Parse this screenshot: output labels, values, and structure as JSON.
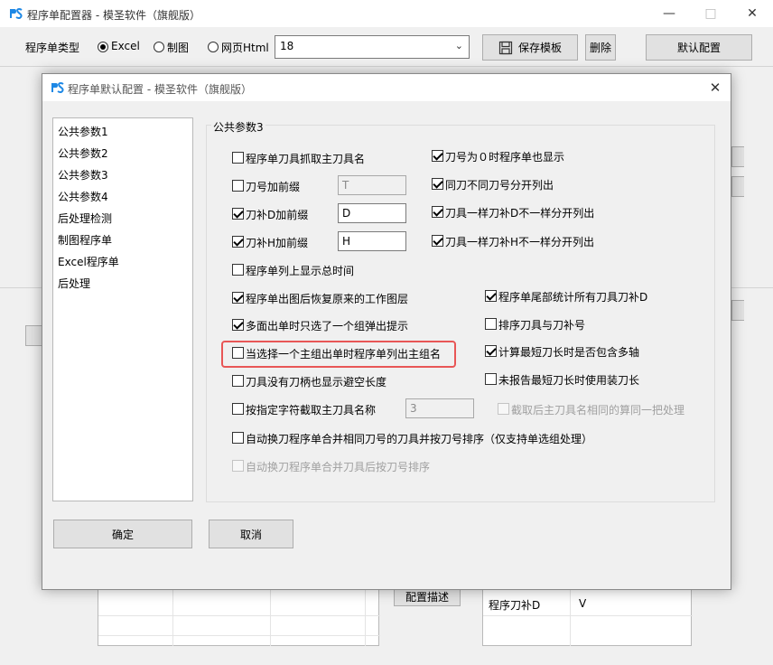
{
  "main_window": {
    "title": "程序单配置器 - 模圣软件（旗舰版）",
    "type_label": "程序单类型",
    "radio_excel": "Excel",
    "radio_draw": "制图",
    "radio_html": "网页Html",
    "combo_value": "18",
    "save_template_label": "保存模板",
    "delete_label": "删除",
    "default_config_label": "默认配置",
    "config_desc_label": "配置描述",
    "bottom_table": {
      "col1": "程序刀补D",
      "col2": "V"
    }
  },
  "dialog": {
    "title": "程序单默认配置 - 模圣软件（旗舰版）",
    "nav_items": [
      {
        "label": "公共参数1"
      },
      {
        "label": "公共参数2"
      },
      {
        "label": "公共参数3"
      },
      {
        "label": "公共参数4"
      },
      {
        "label": "后处理检测"
      },
      {
        "label": "制图程序单"
      },
      {
        "label": "Excel程序单"
      },
      {
        "label": "后处理"
      }
    ],
    "group_title": "公共参数3",
    "options": {
      "opt1": {
        "label": "程序单刀具抓取主刀具名",
        "checked": false
      },
      "opt2": {
        "label": "刀号加前缀",
        "checked": false,
        "value": "T"
      },
      "opt3": {
        "label": "刀补D加前缀",
        "checked": true,
        "value": "D"
      },
      "opt4": {
        "label": "刀补H加前缀",
        "checked": true,
        "value": "H"
      },
      "opt5": {
        "label": "程序单列上显示总时间",
        "checked": false
      },
      "opt6": {
        "label": "程序单出图后恢复原来的工作图层",
        "checked": true
      },
      "opt7": {
        "label": "多面出单时只选了一个组弹出提示",
        "checked": true
      },
      "opt8": {
        "label": "当选择一个主组出单时程序单列出主组名",
        "checked": false
      },
      "opt9": {
        "label": "刀具没有刀柄也显示避空长度",
        "checked": false
      },
      "opt10": {
        "label": "按指定字符截取主刀具名称",
        "checked": false,
        "value": "3"
      },
      "opt11": {
        "label": "自动换刀程序单合并相同刀号的刀具并按刀号排序（仅支持单选组处理）",
        "checked": false
      },
      "opt12": {
        "label": "自动换刀程序单合并刀具后按刀号排序",
        "checked": false,
        "disabled": true
      },
      "opt13": {
        "label": "刀号为０时程序单也显示",
        "checked": true
      },
      "opt14": {
        "label": "同刀不同刀号分开列出",
        "checked": true
      },
      "opt15": {
        "label": "刀具一样刀补D不一样分开列出",
        "checked": true
      },
      "opt16": {
        "label": "刀具一样刀补H不一样分开列出",
        "checked": true
      },
      "opt17": {
        "label": "程序单尾部统计所有刀具刀补D",
        "checked": true
      },
      "opt18": {
        "label": "排序刀具与刀补号",
        "checked": false
      },
      "opt19": {
        "label": "计算最短刀长时是否包含多轴",
        "checked": true
      },
      "opt20": {
        "label": "未报告最短刀长时使用装刀长",
        "checked": false
      },
      "opt21": {
        "label": "截取后主刀具名相同的算同一把处理",
        "checked": false,
        "disabled": true
      }
    },
    "ok_label": "确定",
    "cancel_label": "取消"
  },
  "colors": {
    "highlight": "#e85656",
    "logo": "#1e88e5"
  }
}
